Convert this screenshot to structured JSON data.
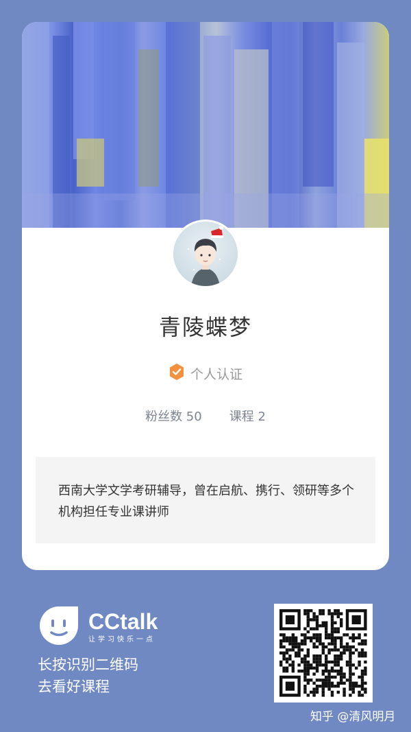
{
  "profile": {
    "name": "青陵蝶梦",
    "certification": "个人认证",
    "fans": "粉丝数 50",
    "courses": "课程 2",
    "intro": "西南大学文学考研辅导，曾在启航、携行、领研等多个机构担任专业课讲师"
  },
  "brand": {
    "name": "CCtalk",
    "slogan": "让学习快乐一点"
  },
  "promo": {
    "line1": "长按识别二维码",
    "line2": "去看好课程"
  },
  "watermark": "知乎 @清风明月",
  "colors": {
    "background": "#7189c3",
    "card": "#ffffff",
    "cert_badge": "#f5913e",
    "intro_bg": "#f4f4f4"
  },
  "icons": {
    "certification": "check-shield-icon",
    "brand": "cctalk-face-icon"
  }
}
